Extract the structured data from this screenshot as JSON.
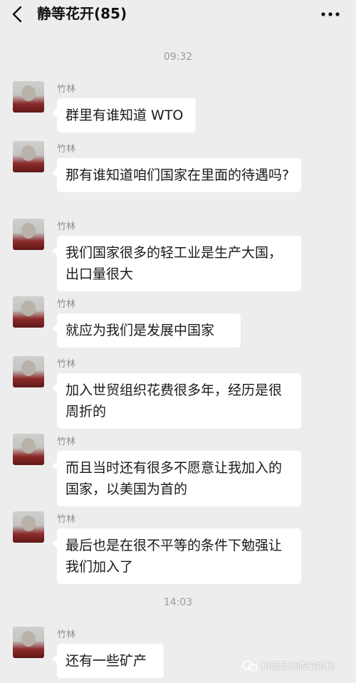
{
  "header": {
    "title": "静等花开(85)",
    "back_icon": "chevron-left-icon",
    "more_icon": "more-dots-icon"
  },
  "timestamps": [
    "09:32",
    "14:03"
  ],
  "messages": [
    {
      "sender": "竹林",
      "text": "群里有谁知道 WTO"
    },
    {
      "sender": "竹林",
      "text": "那有谁知道咱们国家在里面的待遇吗?"
    },
    {
      "sender": "竹林",
      "text": "我们国家很多的轻工业是生产大国，出口量很大"
    },
    {
      "sender": "竹林",
      "text": "就应为我们是发展中国家"
    },
    {
      "sender": "竹林",
      "text": "加入世贸组织花费很多年，经历是很周折的"
    },
    {
      "sender": "竹林",
      "text": "而且当时还有很多不愿意让我加入的国家，以美国为首的"
    },
    {
      "sender": "竹林",
      "text": "最后也是在很不平等的条件下勉强让我们加入了"
    },
    {
      "sender": "竹林",
      "text": "还有一些矿产"
    }
  ],
  "watermark": {
    "text": "利箭反传防骗揭秘"
  },
  "colors": {
    "background": "#ededed",
    "bubble": "#ffffff",
    "text": "#1a1a1a",
    "meta": "#9a9a9a"
  }
}
